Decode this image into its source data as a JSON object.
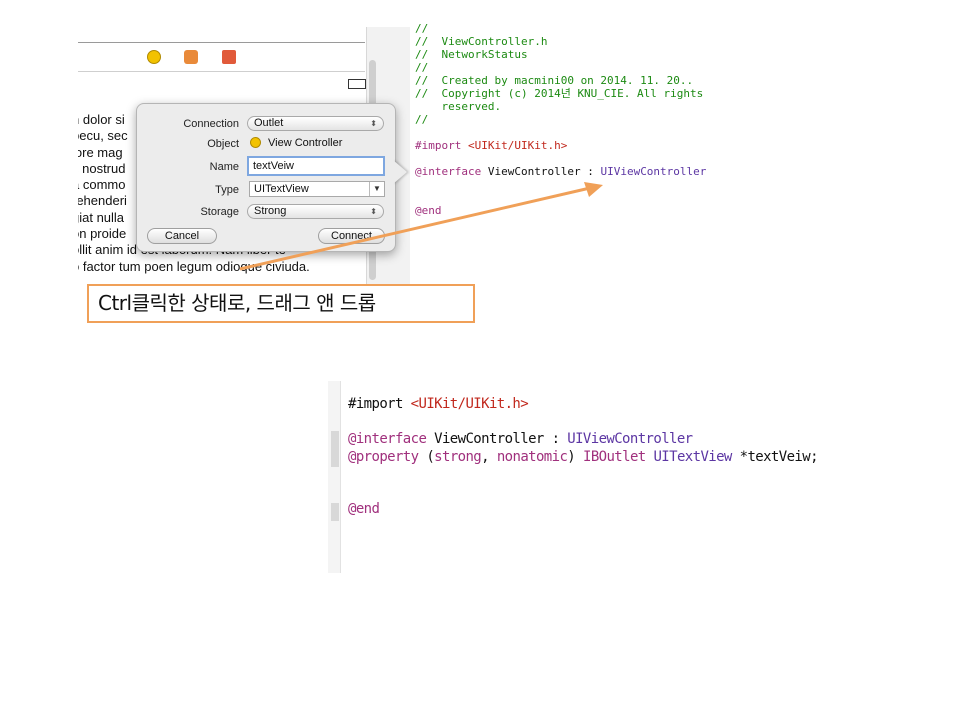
{
  "storyboard": {
    "lorem_lines": [
      "n dolor si",
      "pecu, sec",
      "lore mag",
      "s nostrud",
      "a commo",
      "rehenderi",
      "giat nulla",
      "on proide",
      "ollit anim id est laborum. Nam liber te",
      "o factor tum poen legum odioque civiuda."
    ]
  },
  "code_top": {
    "lines": [
      {
        "t": "//",
        "c": "comment"
      },
      {
        "t": "//  ViewController.h",
        "c": "comment"
      },
      {
        "t": "//  NetworkStatus",
        "c": "comment"
      },
      {
        "t": "//",
        "c": "comment"
      },
      {
        "t": "//  Created by macmini00 on 2014. 11. 20..",
        "c": "comment"
      },
      {
        "t": "//  Copyright (c) 2014년 KNU_CIE. All rights",
        "c": "comment"
      },
      {
        "t": "    reserved.",
        "c": "comment"
      },
      {
        "t": "//",
        "c": "comment"
      }
    ],
    "import_kw": "#import",
    "import_path": "<UIKit/UIKit.h>",
    "interface_kw": "@interface",
    "interface_name": "ViewController :",
    "superclass": "UIViewController",
    "end_kw": "@end"
  },
  "popover": {
    "connection_label": "Connection",
    "connection_value": "Outlet",
    "object_label": "Object",
    "object_value": "View Controller",
    "name_label": "Name",
    "name_value": "textVeiw",
    "type_label": "Type",
    "type_value": "UITextView",
    "storage_label": "Storage",
    "storage_value": "Strong",
    "cancel_label": "Cancel",
    "connect_label": "Connect"
  },
  "annotation": {
    "text": "Ctrl클릭한 상태로, 드래그 앤 드롭"
  },
  "code_bottom": {
    "import_kw": "#import",
    "import_path": "<UIKit/UIKit.h>",
    "interface_kw": "@interface",
    "interface_name": "ViewController :",
    "superclass": "UIViewController",
    "property_kw": "@property",
    "paren_open": "(",
    "strong_kw": "strong",
    "comma": ",",
    "nonatomic_kw": "nonatomic",
    "paren_close": ")",
    "iboutlet": "IBOutlet",
    "type_name": "UITextView",
    "var_name": "*textVeiw;",
    "end_kw": "@end"
  },
  "colors": {
    "comment": "#1c8a12",
    "keyword": "#a0307d",
    "string": "#c1281d",
    "class": "#5c36a3",
    "annotation_border": "#f0a058",
    "arrow": "#f0a058"
  }
}
